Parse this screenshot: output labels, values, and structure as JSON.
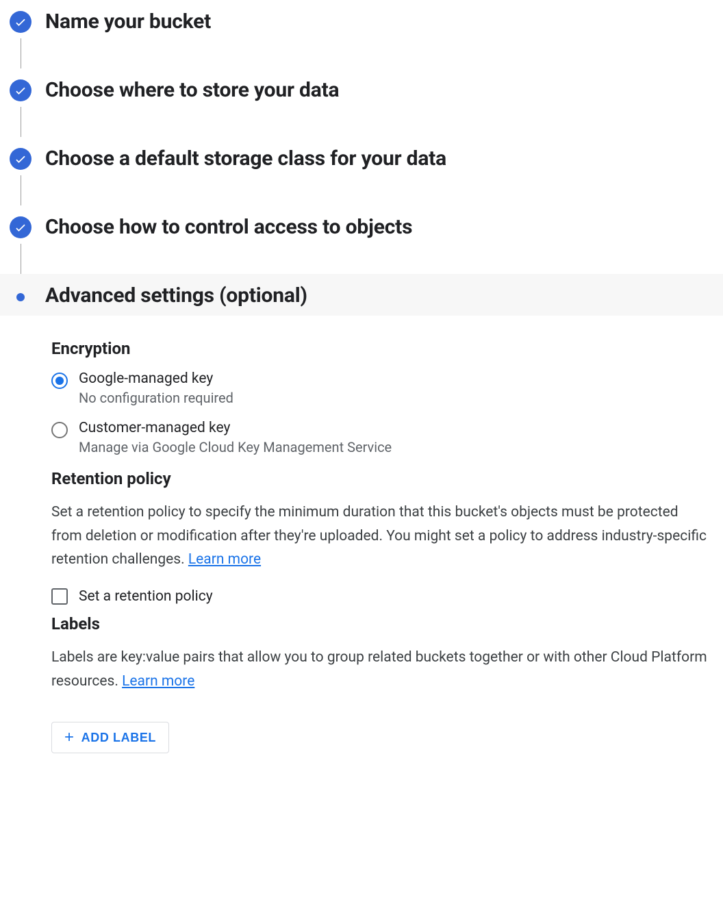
{
  "steps": [
    {
      "label": "Name your bucket",
      "completed": true
    },
    {
      "label": "Choose where to store your data",
      "completed": true
    },
    {
      "label": "Choose a default storage class for your data",
      "completed": true
    },
    {
      "label": "Choose how to control access to objects",
      "completed": true
    },
    {
      "label": "Advanced settings (optional)",
      "active": true
    }
  ],
  "encryption": {
    "heading": "Encryption",
    "options": [
      {
        "label": "Google-managed key",
        "sub": "No configuration required",
        "selected": true
      },
      {
        "label": "Customer-managed key",
        "sub": "Manage via Google Cloud Key Management Service",
        "selected": false
      }
    ]
  },
  "retention": {
    "heading": "Retention policy",
    "body": "Set a retention policy to specify the minimum duration that this bucket's objects must be protected from deletion or modification after they're uploaded. You might set a policy to address industry-specific retention challenges. ",
    "learn_more": "Learn more",
    "checkbox_label": "Set a retention policy"
  },
  "labels": {
    "heading": "Labels",
    "body": "Labels are key:value pairs that allow you to group related buckets together or with other Cloud Platform resources. ",
    "learn_more": "Learn more",
    "add_button": "ADD LABEL"
  }
}
